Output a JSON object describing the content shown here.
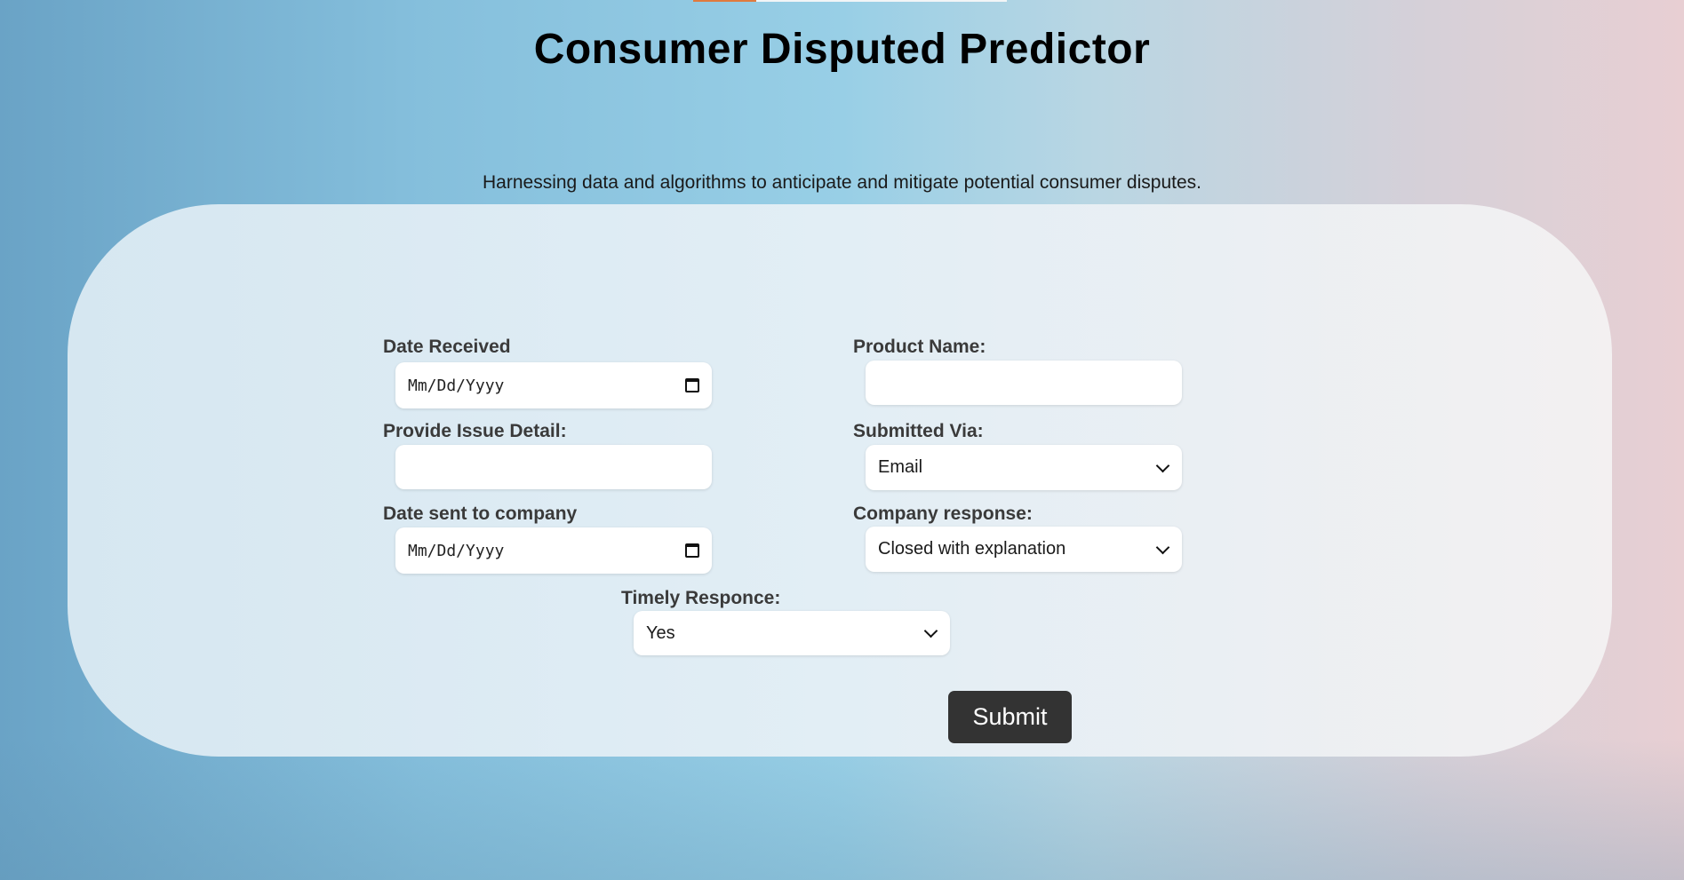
{
  "header": {
    "title": "Consumer Disputed Predictor",
    "subtitle": "Harnessing data and algorithms to anticipate and mitigate potential consumer disputes."
  },
  "form": {
    "date_received": {
      "label": "Date Received",
      "placeholder": "Mm/Dd/Yyyy"
    },
    "product_name": {
      "label": "Product Name:",
      "value": ""
    },
    "issue_detail": {
      "label": "Provide Issue Detail:",
      "value": ""
    },
    "submitted_via": {
      "label": "Submitted Via:",
      "selected": "Email"
    },
    "date_sent": {
      "label": "Date sent to company",
      "placeholder": "Mm/Dd/Yyyy"
    },
    "company_response": {
      "label": "Company response:",
      "selected": "Closed with explanation"
    },
    "timely_response": {
      "label": "Timely Responce:",
      "selected": "Yes"
    },
    "submit_label": "Submit"
  },
  "icons": {
    "date": "calendar-icon",
    "dropdown": "chevron-down-icon"
  },
  "colors": {
    "button": "#333333",
    "loading_bar": "#e07a3e"
  }
}
